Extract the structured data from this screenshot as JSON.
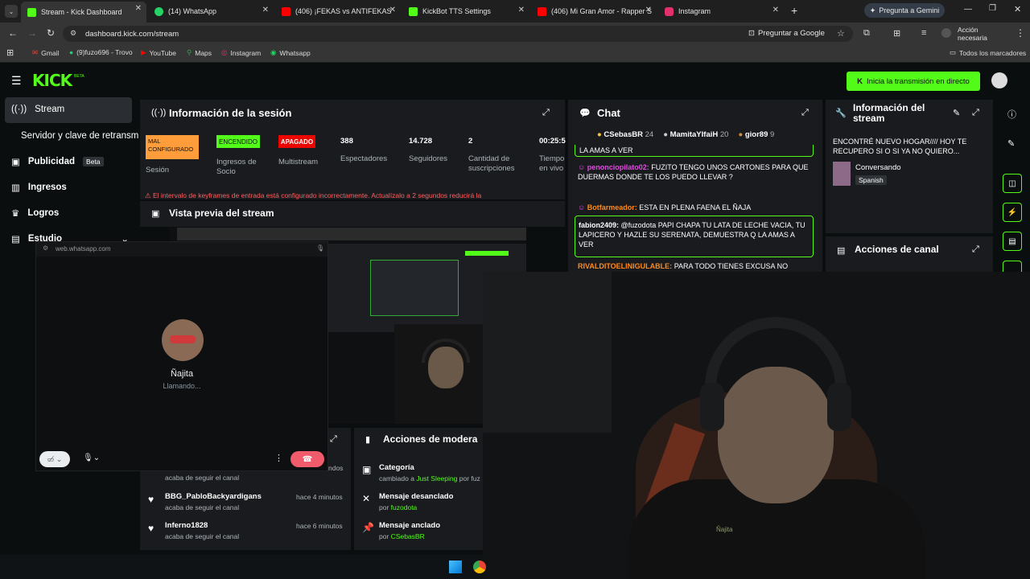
{
  "browser": {
    "tabs": [
      {
        "label": "Stream - Kick Dashboard",
        "color": "#53fc18"
      },
      {
        "label": "(14) WhatsApp",
        "color": "#25d366"
      },
      {
        "label": "(406) ¡FEKAS vs ANTIFEKAS",
        "color": "#ff0000"
      },
      {
        "label": "KickBot TTS Settings",
        "color": "#53fc18"
      },
      {
        "label": "(406) Mi Gran Amor - Rapper S",
        "color": "#ff0000"
      },
      {
        "label": "Instagram",
        "color": "#e1306c"
      }
    ],
    "gemini_label": "Pregunta a Gemini",
    "url": "dashboard.kick.com/stream",
    "google_label": "Preguntar a Google",
    "action_label": "Acción necesaria",
    "bookmarks": [
      "Gmail",
      "(9)fuzo696 - Trovo",
      "YouTube",
      "Maps",
      "Instagram",
      "Whatsapp"
    ],
    "all_bookmarks": "Todos los marcadores"
  },
  "kick": {
    "logo": "KICK",
    "logo_sup": "BETA",
    "go_live": "Inicia la transmisión en directo",
    "sidebar": {
      "stream": "Stream",
      "server": "Servidor y clave de retransm",
      "ads": "Publicidad",
      "ads_badge": "Beta",
      "income": "Ingresos",
      "achievements": "Logros",
      "studio": "Estudio"
    },
    "session": {
      "title": "Información de la sesión",
      "badges": [
        {
          "text": "MAL CONFIGURADO",
          "label": "Sesión",
          "color": "#ff9d3b"
        },
        {
          "text": "ENCENDIDO",
          "label": "Ingresos de Socio",
          "color": "#53fc18"
        },
        {
          "text": "APAGADO",
          "label": "Multistream",
          "color": "#eb0400"
        }
      ],
      "stats": [
        {
          "value": "388",
          "label": "Espectadores"
        },
        {
          "value": "14.728",
          "label": "Seguidores"
        },
        {
          "value": "2",
          "label": "Cantidad de suscripciones"
        },
        {
          "value": "00:25:5",
          "label": "Tiempo en vivo"
        }
      ],
      "warning": "El intervalo de keyframes de entrada está configurado incorrectamente. Actualízalo a 2 segundos reducirá la"
    },
    "preview_title": "Vista previa del stream",
    "chat": {
      "title": "Chat",
      "top": [
        {
          "name": "CSebasBR",
          "count": "24"
        },
        {
          "name": "MamitaYIfaiH",
          "count": "20"
        },
        {
          "name": "gior89",
          "count": "9"
        }
      ],
      "messages": [
        {
          "user": "",
          "text": "LA AMAS A VER"
        },
        {
          "user": "penonciopilato02:",
          "text": "FUZITO TENGO UNOS CARTONES PARA QUE DUERMAS DONDE TE LOS PUEDO LLEVAR ?"
        },
        {
          "user": "Botfarmeador:",
          "text": "ESTA EN PLENA FAENA EL ÑAJA"
        },
        {
          "user": "fabion2409:",
          "text": "@fuzodota PAPI CHAPA TU LATA DE LECHE VACIA, TU LAPICERO Y HAZLE SU SERENATA, DEMUESTRA Q LA AMAS A VER"
        },
        {
          "user": "RIVALDITOELINIGULABLE:",
          "text": "PARA TODO TIENES EXCUSA NO"
        }
      ]
    },
    "stream_info": {
      "title": "Información del stream",
      "stream_title": "ENCONTRÉ NUEVO HOGAR//// HOY TE RECUPERO SI O SI YA NO QUIERO...",
      "category": "Conversando",
      "language": "Spanish"
    },
    "channel_actions": "Acciones de canal",
    "followers": [
      {
        "name": "",
        "sub": "acaba de seguir el canal",
        "time": ""
      },
      {
        "name": "BBG_PabloBackyardigans",
        "sub": "acaba de seguir el canal",
        "time": "hace 4 minutos"
      },
      {
        "name": "Inferno1828",
        "sub": "acaba de seguir el canal",
        "time": "hace 6 minutos"
      }
    ],
    "followers_partial_time": "ndos",
    "mod_actions": {
      "title": "Acciones de modera",
      "items": [
        {
          "title": "Categoría",
          "pre": "cambiado a",
          "value": "Just Sleeping",
          "post": "por fuz"
        },
        {
          "title": "Mensaje desanclado",
          "pre": "por",
          "value": "fuzodota",
          "post": ""
        },
        {
          "title": "Mensaje anclado",
          "pre": "por",
          "value": "CSebasBR",
          "post": ""
        }
      ]
    }
  },
  "whatsapp_popup": {
    "url": "web.whatsapp.com",
    "caller": "Ñajita",
    "status": "Llamando..."
  },
  "webcam": {
    "shirt_text": "Ñajita"
  }
}
